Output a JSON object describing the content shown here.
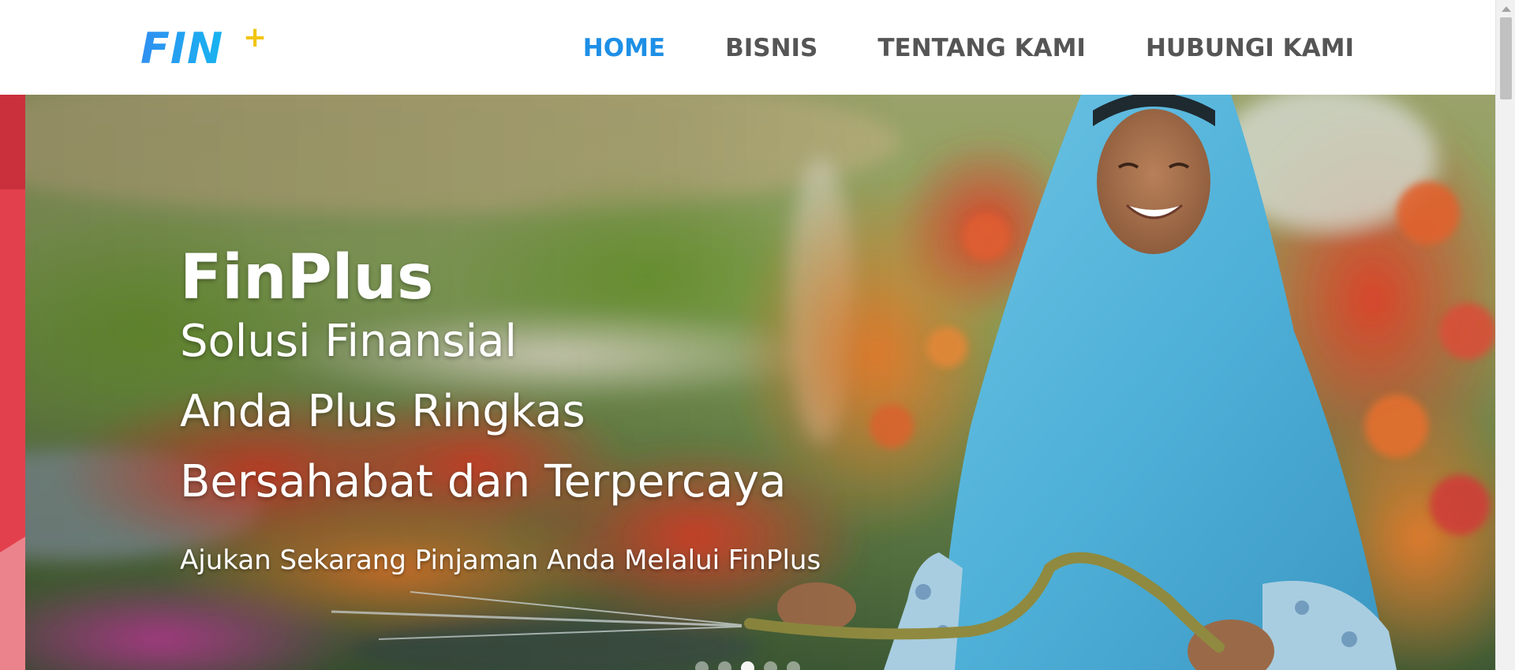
{
  "brand": {
    "logo_text": "FIN",
    "logo_plus": "+",
    "colors": {
      "logo_blue": "#1aa3ec",
      "logo_plus_yellow": "#f2c511",
      "nav_active": "#1e8fe6",
      "nav_default": "#555555"
    }
  },
  "nav": {
    "items": [
      {
        "label": "HOME",
        "active": true
      },
      {
        "label": "BISNIS",
        "active": false
      },
      {
        "label": "TENTANG KAMI",
        "active": false
      },
      {
        "label": "HUBUNGI KAMI",
        "active": false
      }
    ]
  },
  "hero": {
    "title": "FinPlus",
    "lines": [
      "Solusi Finansial",
      "Anda Plus Ringkas",
      "Bersahabat dan Terpercaya"
    ],
    "subtitle": "Ajukan Sekarang Pinjaman Anda Melalui FinPlus",
    "carousel": {
      "slide_count": 5,
      "active_index": 2
    }
  }
}
